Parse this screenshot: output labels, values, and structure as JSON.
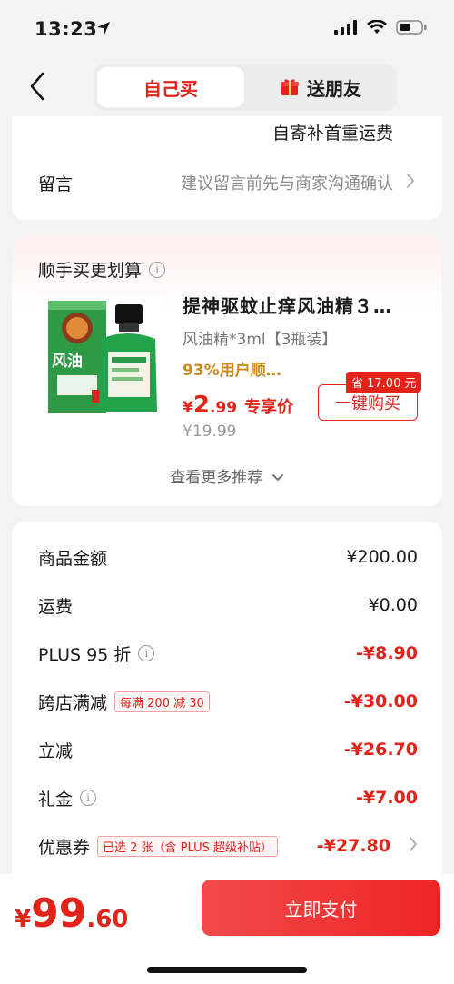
{
  "status_bar": {
    "time": "13:23"
  },
  "nav": {
    "tab_self": "自己买",
    "tab_gift": "送朋友"
  },
  "shipping": {
    "note": "自寄补首重运费"
  },
  "message": {
    "label": "留言",
    "hint": "建议留言前先与商家沟通确认"
  },
  "recommend": {
    "title": "顺手买更划算",
    "product": {
      "name": "提神驱蚊止痒风油精３…",
      "spec": "风油精*3ml【3瓶装】",
      "rating": "93%用户顺…",
      "price_symbol": "¥",
      "price_int": "2",
      "price_dec": ".99",
      "price_tag": "专享价",
      "original_price": "¥19.99",
      "save_badge": "省 17.00 元",
      "buy_label": "一键购买",
      "box_brand": "风油"
    },
    "see_more": "查看更多推荐"
  },
  "summary": {
    "rows": [
      {
        "label": "商品金额",
        "value": "¥200.00"
      },
      {
        "label": "运费",
        "value": "¥0.00"
      },
      {
        "label": "PLUS 95 折",
        "value": "-¥8.90"
      },
      {
        "label": "跨店满减",
        "pill": "每满 200 减 30",
        "value": "-¥30.00"
      },
      {
        "label": "立减",
        "value": "-¥26.70"
      },
      {
        "label": "礼金",
        "value": "-¥7.00"
      },
      {
        "label": "优惠券",
        "pill": "已选 2 张（含 PLUS 超级补贴）",
        "value": "-¥27.80"
      }
    ]
  },
  "footer": {
    "total_symbol": "¥",
    "total_int": "99",
    "total_dec": ".60",
    "pay_label": "立即支付"
  },
  "colors": {
    "accent": "#e2231a",
    "rating": "#c98a1e",
    "background": "#f3f3f3"
  }
}
